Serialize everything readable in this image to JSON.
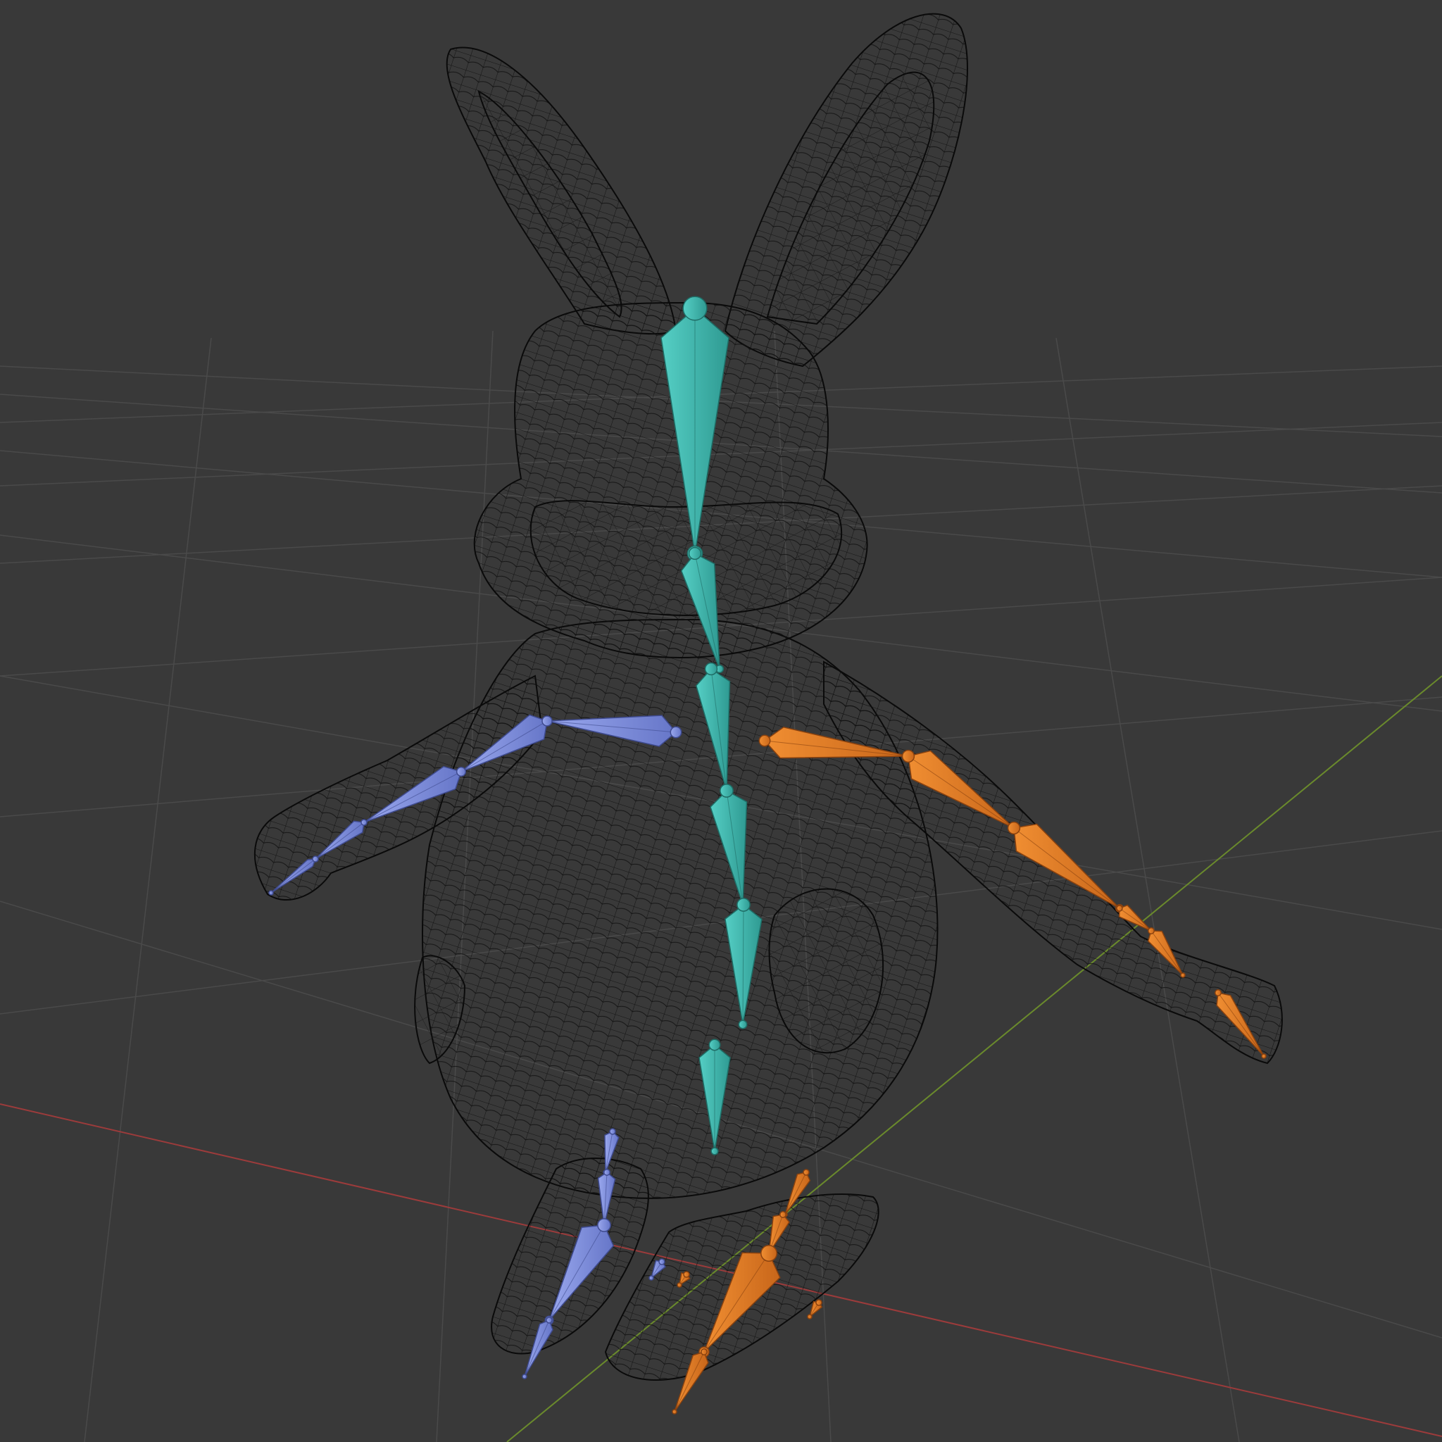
{
  "viewport": {
    "mode": "wireframe",
    "show_floor_grid": true,
    "show_axes": [
      "x",
      "y"
    ],
    "object": "rabbit-mesh",
    "armature_groups": [
      "center",
      "left",
      "right"
    ]
  },
  "colors": {
    "background": "#393939",
    "grid_line": "#4a4a4a",
    "x_axis": "#9c3b3b",
    "y_axis": "#6a8a2c",
    "wire": "#0b0b0b",
    "bone_center": "#3fb6ad",
    "bone_left": "#7f8fd9",
    "bone_right": "#e07a23"
  }
}
